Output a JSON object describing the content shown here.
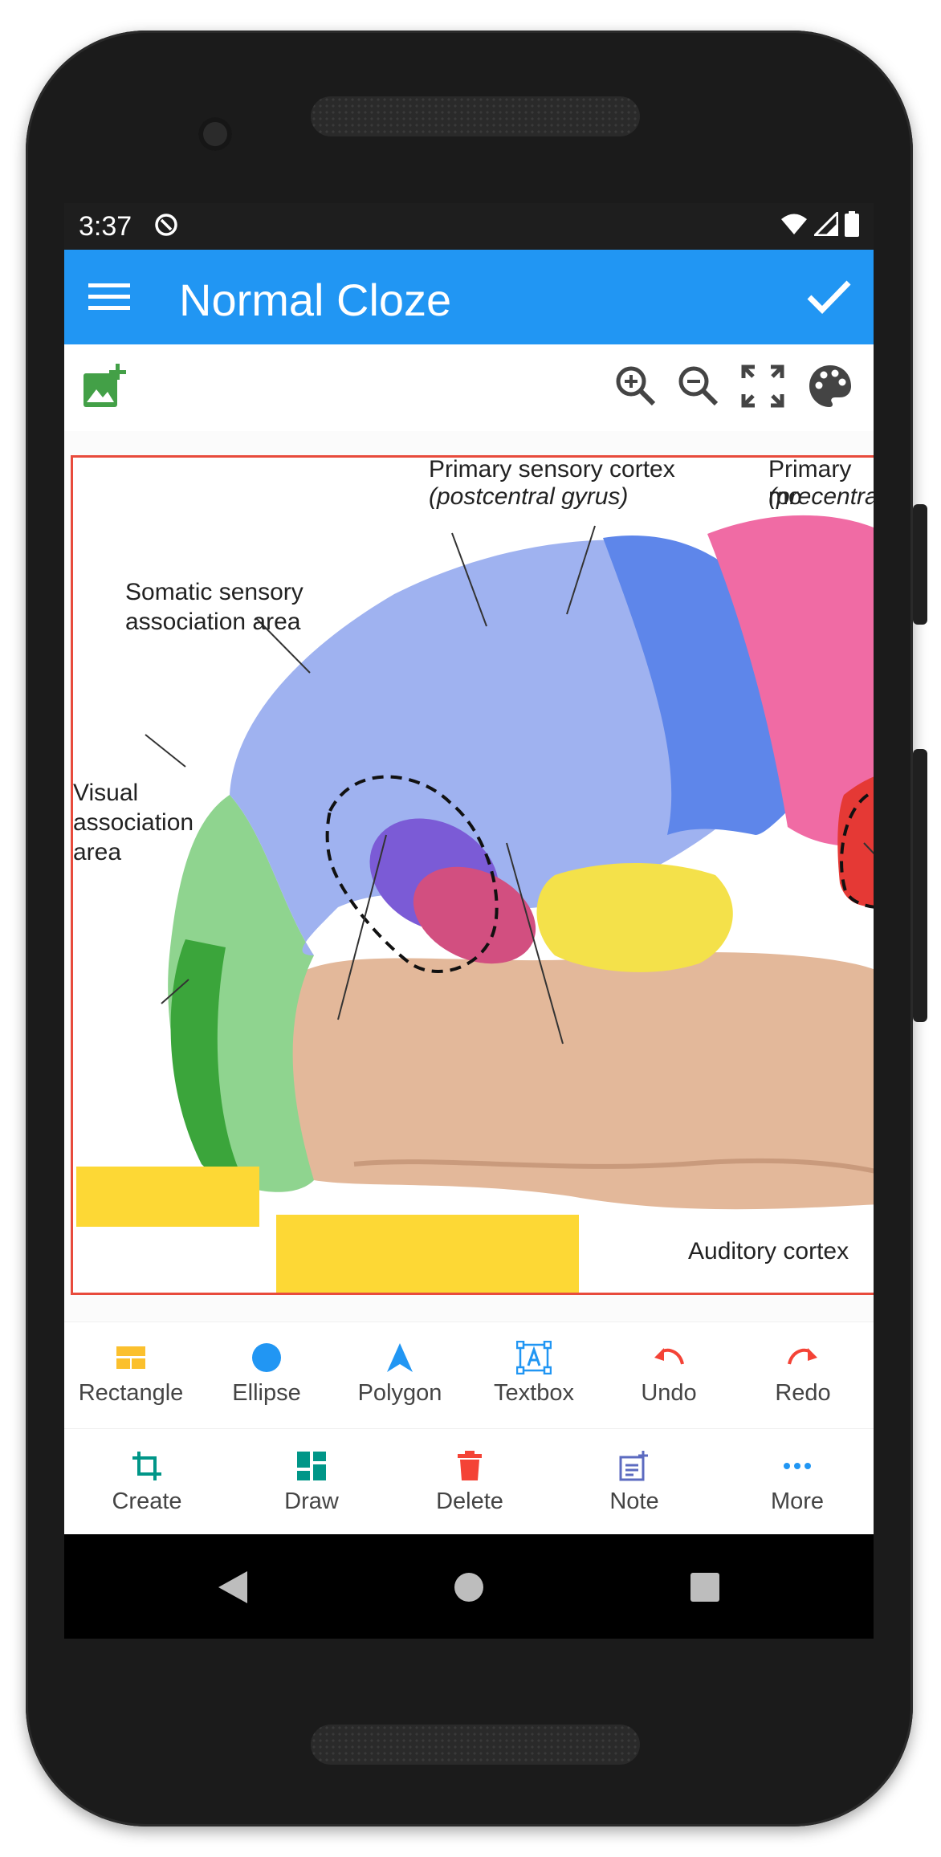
{
  "status_bar": {
    "time": "3:37"
  },
  "app_bar": {
    "title": "Normal Cloze"
  },
  "image_labels": {
    "primary_sensory": "Primary sensory cortex",
    "primary_sensory_sub": "(postcentral gyrus)",
    "primary_motor": "Primary mo",
    "primary_motor_sub": "(precentral",
    "somatic_1": "Somatic sensory",
    "somatic_2": "association area",
    "visual_1": "Visual",
    "visual_2": "association",
    "visual_3": "area",
    "auditory": "Auditory cortex"
  },
  "shape_tools": [
    {
      "label": "Rectangle",
      "icon": "rectangle-icon",
      "color": "#fbc02d"
    },
    {
      "label": "Ellipse",
      "icon": "ellipse-icon",
      "color": "#2196f3"
    },
    {
      "label": "Polygon",
      "icon": "polygon-icon",
      "color": "#2196f3"
    },
    {
      "label": "Textbox",
      "icon": "textbox-icon",
      "color": "#2196f3"
    },
    {
      "label": "Undo",
      "icon": "undo-icon",
      "color": "#f44336"
    },
    {
      "label": "Redo",
      "icon": "redo-icon",
      "color": "#f44336"
    }
  ],
  "bottom_nav": [
    {
      "label": "Create",
      "icon": "crop-icon",
      "color": "#009688"
    },
    {
      "label": "Draw",
      "icon": "dashboard-icon",
      "color": "#009688"
    },
    {
      "label": "Delete",
      "icon": "trash-icon",
      "color": "#f44336"
    },
    {
      "label": "Note",
      "icon": "note-add-icon",
      "color": "#5c6bc0"
    },
    {
      "label": "More",
      "icon": "more-dots-icon",
      "color": "#2196f3"
    }
  ],
  "colors": {
    "app_bar": "#2196f3",
    "occlusion": "#fdd835",
    "canvas_border": "#e84b3c",
    "add_image": "#43a047"
  }
}
